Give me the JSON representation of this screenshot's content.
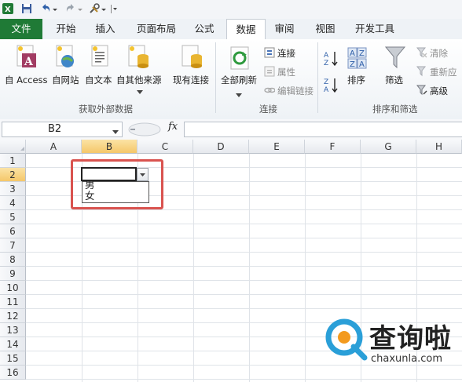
{
  "tabs": [
    {
      "id": "file",
      "label": "文件"
    },
    {
      "id": "home",
      "label": "开始"
    },
    {
      "id": "insert",
      "label": "插入"
    },
    {
      "id": "layout",
      "label": "页面布局"
    },
    {
      "id": "formula",
      "label": "公式"
    },
    {
      "id": "data",
      "label": "数据"
    },
    {
      "id": "review",
      "label": "审阅"
    },
    {
      "id": "view",
      "label": "视图"
    },
    {
      "id": "dev",
      "label": "开发工具"
    }
  ],
  "ribbon": {
    "get_external": {
      "access": "自 Access",
      "web": "自网站",
      "text": "自文本",
      "other": "自其他来源",
      "existing": "现有连接",
      "group": "获取外部数据"
    },
    "connections": {
      "refresh_all": "全部刷新",
      "connections": "连接",
      "properties": "属性",
      "edit_links": "编辑链接",
      "group": "连接"
    },
    "sort_filter": {
      "sort": "排序",
      "filter": "筛选",
      "clear": "清除",
      "reapply": "重新应",
      "advanced": "高级",
      "group": "排序和筛选"
    }
  },
  "formula_bar": {
    "name_box": "B2",
    "fx": "fx",
    "formula": ""
  },
  "columns": [
    "A",
    "B",
    "C",
    "D",
    "E",
    "F",
    "G",
    "H"
  ],
  "rows": [
    "1",
    "2",
    "3",
    "4",
    "5",
    "6",
    "7",
    "8",
    "9",
    "10",
    "11",
    "12",
    "13",
    "14",
    "15",
    "16"
  ],
  "dropdown": {
    "cell": "B2",
    "options": [
      "男",
      "女"
    ]
  },
  "watermark": {
    "name": "查询啦",
    "url": "chaxunla.com"
  },
  "colors": {
    "file_tab": "#1f7a36",
    "highlight_box": "#d9534f",
    "selected_header": "#f5c769",
    "watermark_blue": "#2a9fd8"
  }
}
